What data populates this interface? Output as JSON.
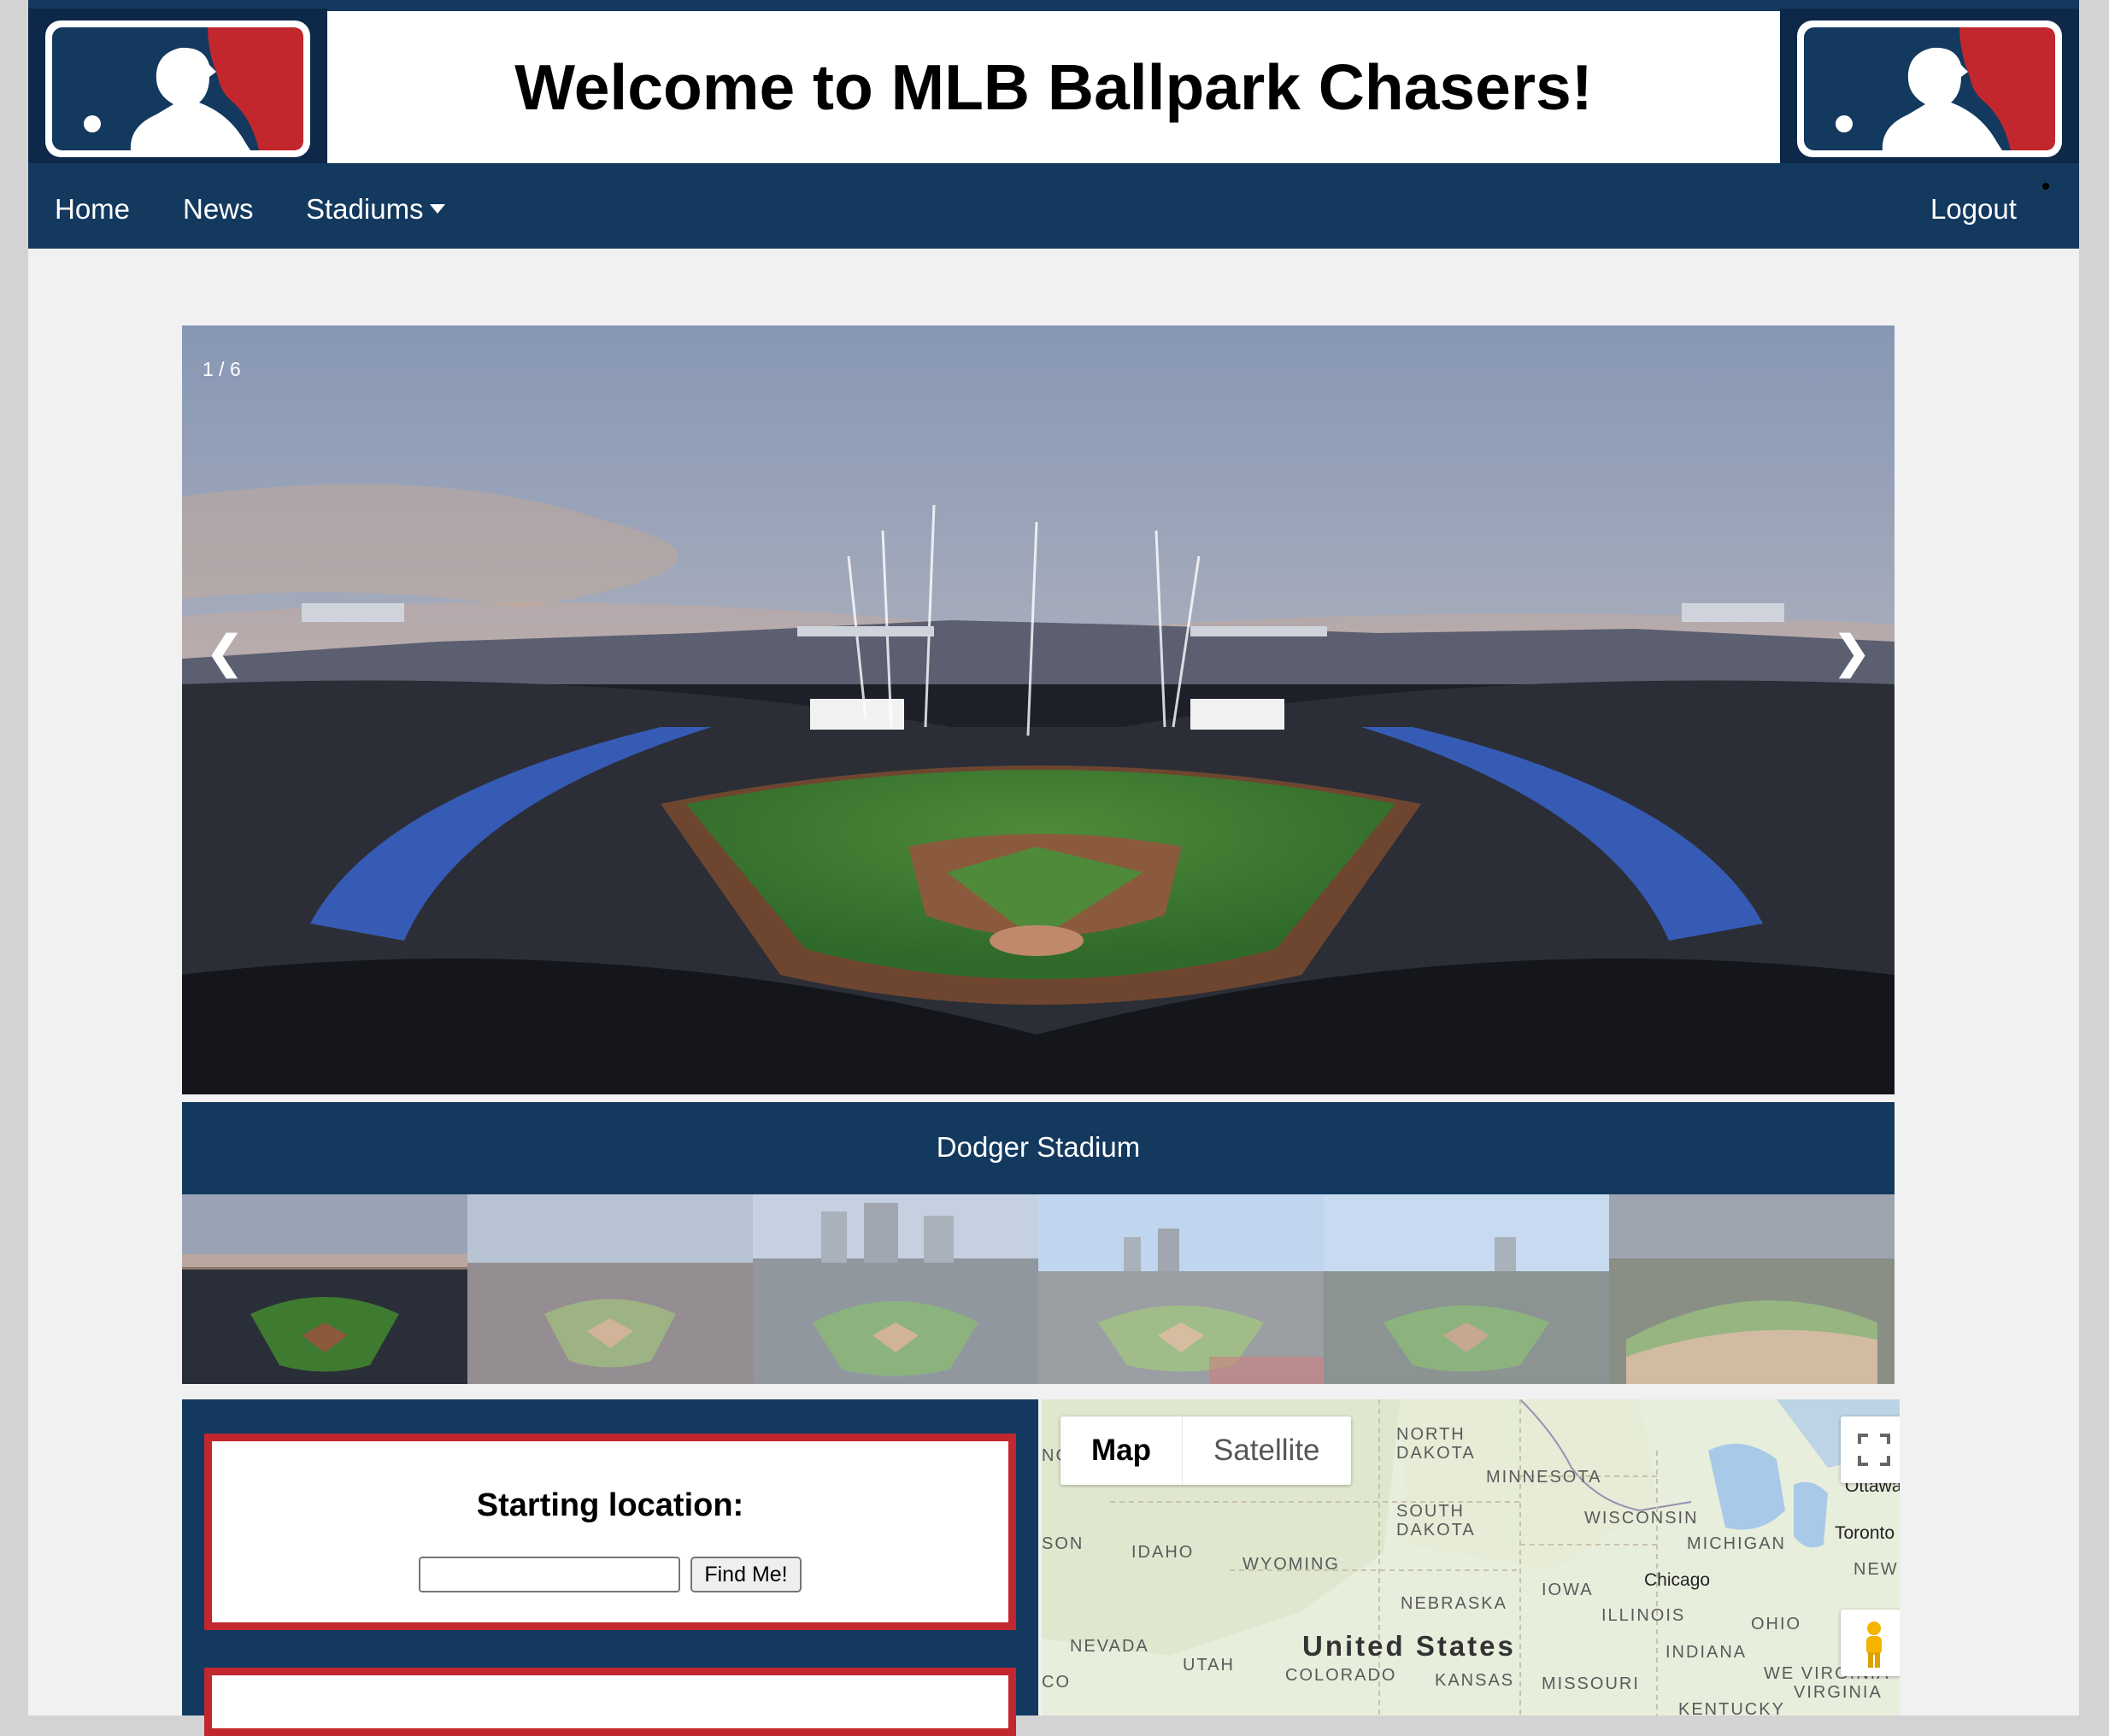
{
  "header": {
    "title": "Welcome to MLB Ballpark Chasers!",
    "logo_icon": "mlb-logo-icon"
  },
  "nav": {
    "home": "Home",
    "news": "News",
    "stadiums": "Stadiums",
    "logout": "Logout"
  },
  "slideshow": {
    "counter": "1 / 6",
    "prev": "❮",
    "next": "❯",
    "caption": "Dodger Stadium",
    "thumbnail_count": 6,
    "active_index": 1
  },
  "finder": {
    "heading": "Starting location:",
    "input_value": "",
    "button": "Find Me!"
  },
  "map": {
    "type_map": "Map",
    "type_satellite": "Satellite",
    "country": "United States",
    "labels": {
      "north_dakota_1": "NORTH",
      "north_dakota_2": "DAKOTA",
      "south_dakota_1": "SOUTH",
      "south_dakota_2": "DAKOTA",
      "minnesota": "MINNESOTA",
      "wisconsin": "WISCONSIN",
      "michigan": "MICHIGAN",
      "idaho": "IDAHO",
      "wyoming": "WYOMING",
      "iowa": "IOWA",
      "nebraska": "NEBRASKA",
      "illinois": "ILLINOIS",
      "indiana": "INDIANA",
      "ohio": "OHIO",
      "nevada": "NEVADA",
      "utah": "UTAH",
      "colorado": "COLORADO",
      "kansas": "KANSAS",
      "missouri": "MISSOURI",
      "kentucky": "KENTUCKY",
      "virginia": "VIRGINIA",
      "west_virginia": "WE VIRGINIA",
      "new": "NEW",
      "son": "SON",
      "ng": "NG",
      "co": "CO",
      "ottawa": "Ottawa",
      "toronto": "Toronto",
      "chicago": "Chicago"
    },
    "fullscreen_icon": "fullscreen-icon",
    "pegman_icon": "pegman-icon"
  },
  "colors": {
    "navy": "#13395f",
    "red": "#c1272d",
    "page_bg": "#f1f1f1"
  }
}
